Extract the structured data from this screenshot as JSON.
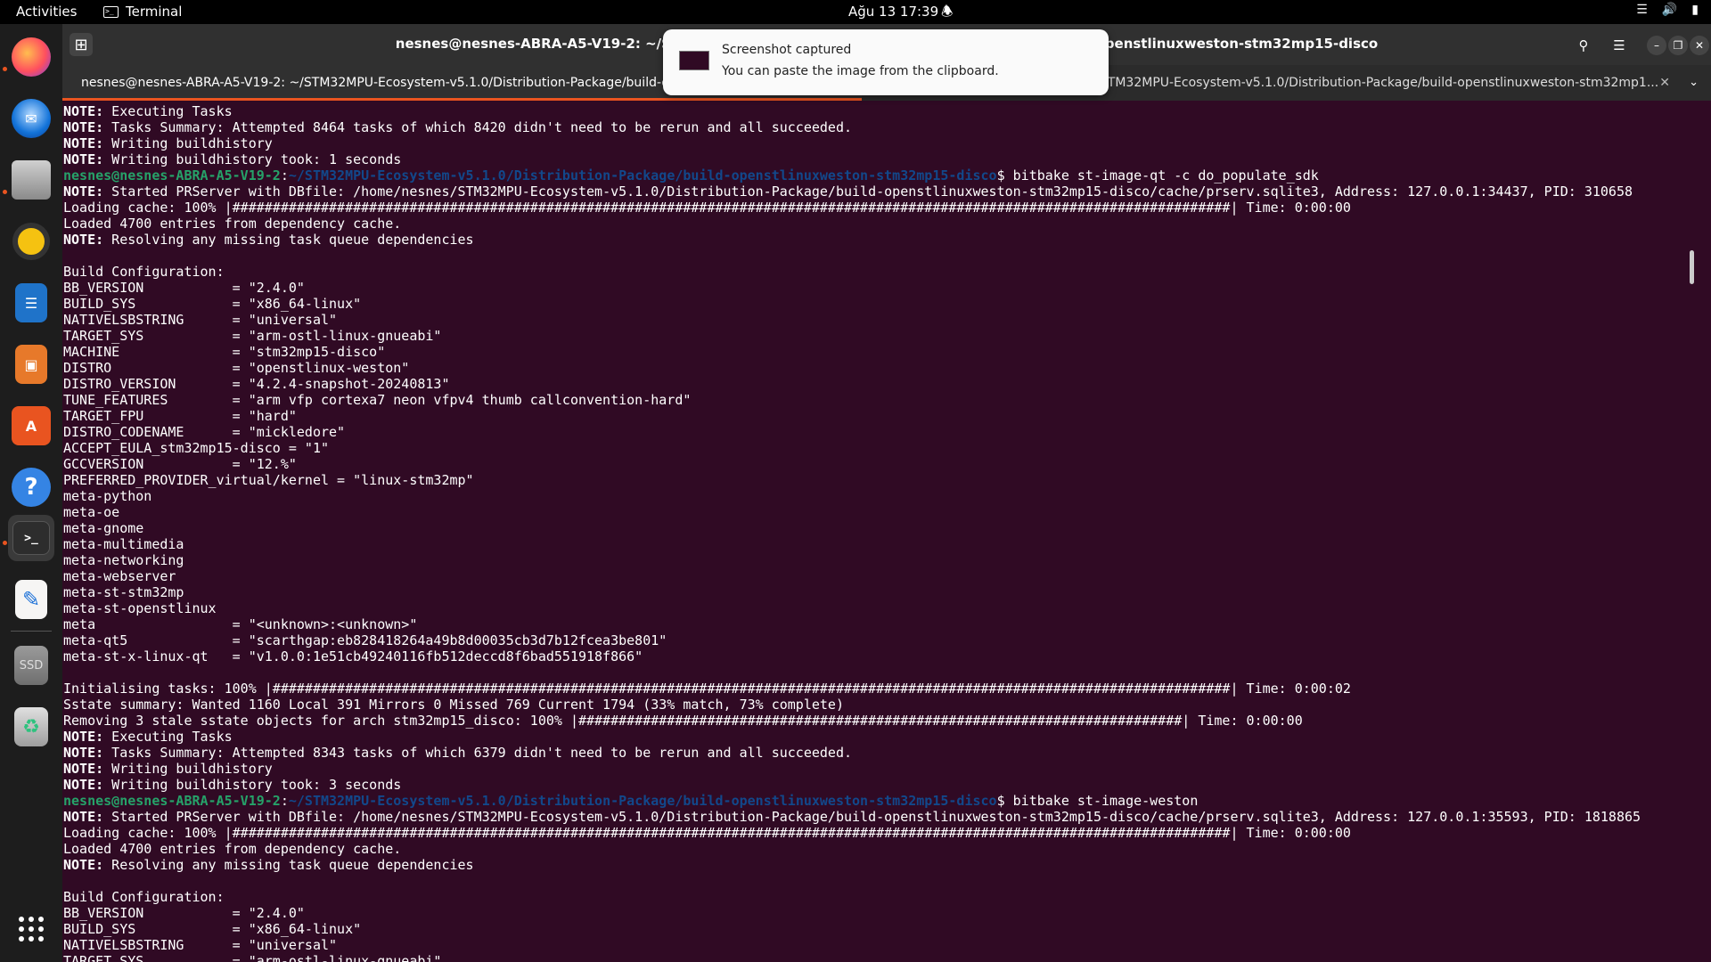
{
  "topbar": {
    "activities": "Activities",
    "app_name": "Terminal",
    "datetime": "Ağu 13  17:39",
    "icons": [
      "wifi-icon",
      "volume-icon",
      "battery-icon",
      "bell-icon"
    ]
  },
  "dock": {
    "items": [
      "firefox",
      "thunderbird",
      "files",
      "rhythmbox",
      "libreoffice-writer",
      "libreoffice-impress",
      "app-center",
      "help",
      "terminal",
      "text-editor",
      "ssd",
      "trash"
    ],
    "ssd_label": "SSD"
  },
  "window": {
    "title": "nesnes@nesnes-ABRA-A5-V19-2: ~/STM32MPU-Ecosystem-v5.1.0/Distribution-Package/build-openstlinuxweston-stm32mp15-disco",
    "tab1": "nesnes@nesnes-ABRA-A5-V19-2: ~/STM32MPU-Ecosystem-v5.1.0/Distribution-Package/build-openstlinuxweston-stm32mp1...",
    "tab2": "nesnes@nesnes-ABRA-A5-V19-2: ~/STM32MPU-Ecosystem-v5.1.0/Distribution-Package/build-openstlinuxweston-stm32mp1..."
  },
  "notification": {
    "title": "Screenshot captured",
    "body": "You can paste the image from the clipboard."
  },
  "terminal": {
    "prompt_user": "nesnes@nesnes-ABRA-A5-V19-2",
    "prompt_path": "~/STM32MPU-Ecosystem-v5.1.0/Distribution-Package/build-openstlinuxweston-stm32mp15-disco",
    "lines": [
      {
        "t": "note",
        "s": " Executing Tasks"
      },
      {
        "t": "note",
        "s": " Tasks Summary: Attempted 8464 tasks of which 8420 didn't need to be rerun and all succeeded."
      },
      {
        "t": "note",
        "s": " Writing buildhistory"
      },
      {
        "t": "note",
        "s": " Writing buildhistory took: 1 seconds"
      },
      {
        "t": "prompt",
        "s": "$ bitbake st-image-qt -c do_populate_sdk"
      },
      {
        "t": "note",
        "s": " Started PRServer with DBfile: /home/nesnes/STM32MPU-Ecosystem-v5.1.0/Distribution-Package/build-openstlinuxweston-stm32mp15-disco/cache/prserv.sqlite3, Address: 127.0.0.1:34437, PID: 310658"
      },
      {
        "t": "text",
        "s": "Loading cache: 100% |############################################################################################################################| Time: 0:00:00"
      },
      {
        "t": "text",
        "s": "Loaded 4700 entries from dependency cache."
      },
      {
        "t": "note",
        "s": " Resolving any missing task queue dependencies"
      },
      {
        "t": "text",
        "s": ""
      },
      {
        "t": "text",
        "s": "Build Configuration:"
      },
      {
        "t": "text",
        "s": "BB_VERSION           = \"2.4.0\""
      },
      {
        "t": "text",
        "s": "BUILD_SYS            = \"x86_64-linux\""
      },
      {
        "t": "text",
        "s": "NATIVELSBSTRING      = \"universal\""
      },
      {
        "t": "text",
        "s": "TARGET_SYS           = \"arm-ostl-linux-gnueabi\""
      },
      {
        "t": "text",
        "s": "MACHINE              = \"stm32mp15-disco\""
      },
      {
        "t": "text",
        "s": "DISTRO               = \"openstlinux-weston\""
      },
      {
        "t": "text",
        "s": "DISTRO_VERSION       = \"4.2.4-snapshot-20240813\""
      },
      {
        "t": "text",
        "s": "TUNE_FEATURES        = \"arm vfp cortexa7 neon vfpv4 thumb callconvention-hard\""
      },
      {
        "t": "text",
        "s": "TARGET_FPU           = \"hard\""
      },
      {
        "t": "text",
        "s": "DISTRO_CODENAME      = \"mickledore\""
      },
      {
        "t": "text",
        "s": "ACCEPT_EULA_stm32mp15-disco = \"1\""
      },
      {
        "t": "text",
        "s": "GCCVERSION           = \"12.%\""
      },
      {
        "t": "text",
        "s": "PREFERRED_PROVIDER_virtual/kernel = \"linux-stm32mp\""
      },
      {
        "t": "text",
        "s": "meta-python"
      },
      {
        "t": "text",
        "s": "meta-oe"
      },
      {
        "t": "text",
        "s": "meta-gnome"
      },
      {
        "t": "text",
        "s": "meta-multimedia"
      },
      {
        "t": "text",
        "s": "meta-networking"
      },
      {
        "t": "text",
        "s": "meta-webserver"
      },
      {
        "t": "text",
        "s": "meta-st-stm32mp"
      },
      {
        "t": "text",
        "s": "meta-st-openstlinux"
      },
      {
        "t": "text",
        "s": "meta                 = \"<unknown>:<unknown>\""
      },
      {
        "t": "text",
        "s": "meta-qt5             = \"scarthgap:eb828418264a49b8d00035cb3d7b12fcea3be801\""
      },
      {
        "t": "text",
        "s": "meta-st-x-linux-qt   = \"v1.0.0:1e51cb49240116fb512deccd8f6bad551918f866\""
      },
      {
        "t": "text",
        "s": ""
      },
      {
        "t": "text",
        "s": "Initialising tasks: 100% |#######################################################################################################################| Time: 0:00:02"
      },
      {
        "t": "text",
        "s": "Sstate summary: Wanted 1160 Local 391 Mirrors 0 Missed 769 Current 1794 (33% match, 73% complete)"
      },
      {
        "t": "text",
        "s": "Removing 3 stale sstate objects for arch stm32mp15_disco: 100% |###########################################################################| Time: 0:00:00"
      },
      {
        "t": "note",
        "s": " Executing Tasks"
      },
      {
        "t": "note",
        "s": " Tasks Summary: Attempted 8343 tasks of which 6379 didn't need to be rerun and all succeeded."
      },
      {
        "t": "note",
        "s": " Writing buildhistory"
      },
      {
        "t": "note",
        "s": " Writing buildhistory took: 3 seconds"
      },
      {
        "t": "prompt",
        "s": "$ bitbake st-image-weston"
      },
      {
        "t": "note",
        "s": " Started PRServer with DBfile: /home/nesnes/STM32MPU-Ecosystem-v5.1.0/Distribution-Package/build-openstlinuxweston-stm32mp15-disco/cache/prserv.sqlite3, Address: 127.0.0.1:35593, PID: 1818865"
      },
      {
        "t": "text",
        "s": "Loading cache: 100% |############################################################################################################################| Time: 0:00:00"
      },
      {
        "t": "text",
        "s": "Loaded 4700 entries from dependency cache."
      },
      {
        "t": "note",
        "s": " Resolving any missing task queue dependencies"
      },
      {
        "t": "text",
        "s": ""
      },
      {
        "t": "text",
        "s": "Build Configuration:"
      },
      {
        "t": "text",
        "s": "BB_VERSION           = \"2.4.0\""
      },
      {
        "t": "text",
        "s": "BUILD_SYS            = \"x86_64-linux\""
      },
      {
        "t": "text",
        "s": "NATIVELSBSTRING      = \"universal\""
      },
      {
        "t": "text",
        "s": "TARGET_SYS           = \"arm-ostl-linux-gnueabi\""
      }
    ]
  }
}
